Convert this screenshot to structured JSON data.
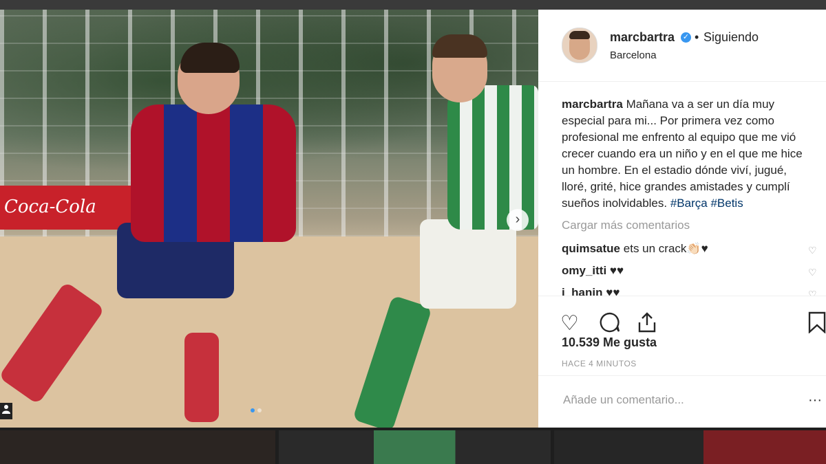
{
  "post": {
    "carousel_next_glyph": "›",
    "ad_text": "Coca-Cola",
    "carousel_total": 2,
    "carousel_current": 1
  },
  "header": {
    "username": "marcbartra",
    "verified_glyph": "✓",
    "bullet": "•",
    "follow_state": "Siguiendo",
    "location": "Barcelona"
  },
  "caption": {
    "username": "marcbartra",
    "text": "Mañana va a ser un día muy especial para mi... Por primera vez como profesional me enfrento al equipo que me vió crecer cuando era un niño y en el que me hice un hombre. En el estadio dónde viví, jugué, lloré, grité, hice grandes amistades y cumplí sueños inolvidables.",
    "hashtags": [
      "#Barça",
      "#Betis"
    ]
  },
  "load_more": "Cargar más comentarios",
  "comments": [
    {
      "user": "quimsatue",
      "text": "ets un crack👏🏻♥"
    },
    {
      "user": "omy_itti",
      "text": "♥♥"
    },
    {
      "user": "i_hanin",
      "text": "♥♥"
    }
  ],
  "actions": {
    "like_icon": "♡",
    "comment_icon": "◯",
    "share_icon": "⇧",
    "save_icon": "⛉"
  },
  "likes": "10.539 Me gusta",
  "timestamp": "HACE 4 MINUTOS",
  "comment_input": {
    "placeholder": "Añade un comentario...",
    "more_glyph": "···"
  },
  "colors": {
    "link": "#003569",
    "verified": "#3897f0",
    "muted": "#999999"
  }
}
